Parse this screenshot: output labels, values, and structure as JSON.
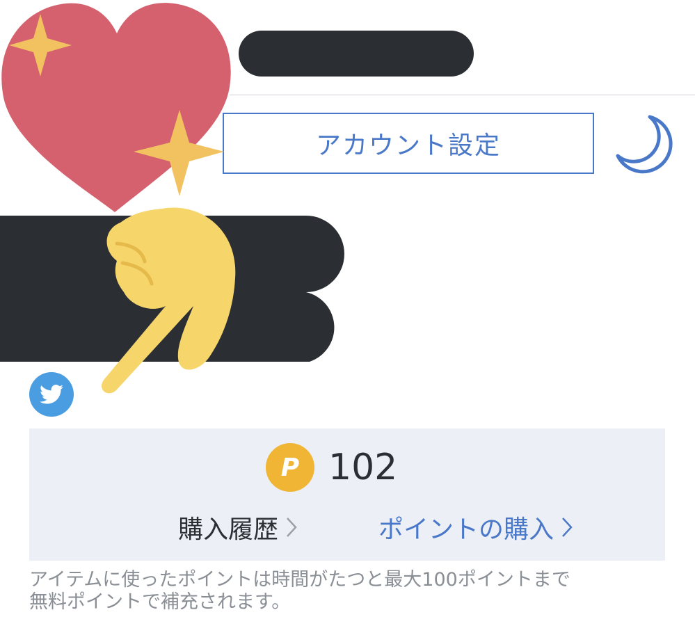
{
  "account": {
    "settings_label": "アカウント設定"
  },
  "icons": {
    "theme": "moon-icon",
    "social": "twitter-icon",
    "decoration_heart": "sparkling-heart-icon",
    "decoration_hand": "pointing-down-hand-icon",
    "coin": "point-coin-icon"
  },
  "points": {
    "coin_letter": "P",
    "value": "102",
    "history_label": "購入履歴",
    "buy_label": "ポイントの購入"
  },
  "notice": {
    "line1": "アイテムに使ったポイントは時間がたつと最大100ポイントまで",
    "line2": "無料ポイントで補充されます。"
  },
  "colors": {
    "accent": "#4a78c9",
    "panel": "#eceff5",
    "coin": "#f0b534",
    "twitter": "#4a9de0",
    "redaction": "#2b2f33"
  }
}
